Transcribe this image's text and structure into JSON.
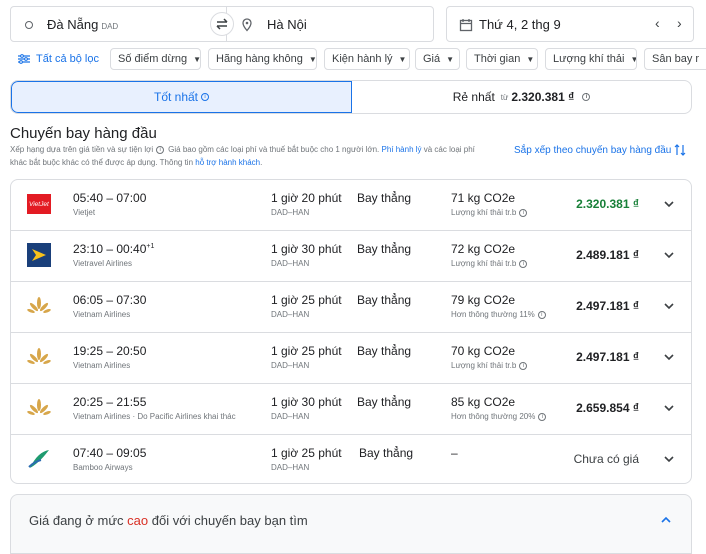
{
  "search": {
    "origin": "Đà Nẵng",
    "origin_code": "DAD",
    "destination": "Hà Nội",
    "date": "Thứ 4, 2 thg 9"
  },
  "filters": {
    "all_label": "Tất cả bộ lọc",
    "chips": [
      "Số điểm dừng",
      "Hãng hàng không",
      "Kiện hành lý",
      "Giá",
      "Thời gian",
      "Lượng khí thải",
      "Sân bay r"
    ]
  },
  "tabs": {
    "best": "Tốt nhất",
    "cheapest": "Rẻ nhất",
    "cheapest_from": "từ",
    "cheapest_price": "2.320.381 ₫"
  },
  "section": {
    "title": "Chuyến bay hàng đầu",
    "desc_1": "Xếp hạng dựa trên giá tiền và sự tiện lợi",
    "desc_2": "Giá bao gồm các loại phí và thuế bắt buộc cho 1 người lớn.",
    "desc_link_1": "Phí hành lý",
    "desc_3": "và các loại phí",
    "desc_4": "khác bắt buộc khác có thể được áp dụng. Thông tin",
    "desc_link_2": "hỗ trợ hành khách",
    "desc_5": ".",
    "sort_label": "Sắp xếp theo chuyến bay hàng đầu"
  },
  "flights": [
    {
      "times": "05:40 – 07:00",
      "plus": "",
      "airline": "Vietjet",
      "duration": "1 giờ 20 phút",
      "route": "DAD–HAN",
      "stops": "Bay thẳng",
      "emissions": "71 kg CO2e",
      "emissions_note": "Lượng khí thải tr.b",
      "price": "2.320.381 ₫",
      "price_color": "#188038",
      "logo": "vietjet"
    },
    {
      "times": "23:10 – 00:40",
      "plus": "+1",
      "airline": "Vietravel Airlines",
      "duration": "1 giờ 30 phút",
      "route": "DAD–HAN",
      "stops": "Bay thẳng",
      "emissions": "72 kg CO2e",
      "emissions_note": "Lượng khí thải tr.b",
      "price": "2.489.181 ₫",
      "price_color": "#202124",
      "logo": "vietravel"
    },
    {
      "times": "06:05 – 07:30",
      "plus": "",
      "airline": "Vietnam Airlines",
      "duration": "1 giờ 25 phút",
      "route": "DAD–HAN",
      "stops": "Bay thẳng",
      "emissions": "79 kg CO2e",
      "emissions_note": "Hơn thông thường 11%",
      "price": "2.497.181 ₫",
      "price_color": "#202124",
      "logo": "vietnam"
    },
    {
      "times": "19:25 – 20:50",
      "plus": "",
      "airline": "Vietnam Airlines",
      "duration": "1 giờ 25 phút",
      "route": "DAD–HAN",
      "stops": "Bay thẳng",
      "emissions": "70 kg CO2e",
      "emissions_note": "Lượng khí thải tr.b",
      "price": "2.497.181 ₫",
      "price_color": "#202124",
      "logo": "vietnam"
    },
    {
      "times": "20:25 – 21:55",
      "plus": "",
      "airline": "Vietnam Airlines · Do Pacific Airlines khai thác",
      "duration": "1 giờ 30 phút",
      "route": "DAD–HAN",
      "stops": "Bay thẳng",
      "emissions": "85 kg CO2e",
      "emissions_note": "Hơn thông thường 20%",
      "price": "2.659.854 ₫",
      "price_color": "#202124",
      "logo": "vietnam"
    },
    {
      "times": "07:40 – 09:05",
      "plus": "",
      "airline": "Bamboo Airways",
      "duration": "1 giờ 25 phút",
      "route": "DAD–HAN",
      "stops": "Bay thẳng",
      "emissions": "–",
      "emissions_note": "",
      "price": "Chưa có giá",
      "price_color": "#3c4043",
      "logo": "bamboo"
    }
  ],
  "price_insight": {
    "prefix": "Giá đang ở mức",
    "level": "cao",
    "suffix": "đối với chuyến bay bạn tìm"
  },
  "colors": {
    "accent": "#1a73e8",
    "cheap": "#188038",
    "high": "#d93025",
    "tab_selected_bg": "#e8f0fe"
  }
}
